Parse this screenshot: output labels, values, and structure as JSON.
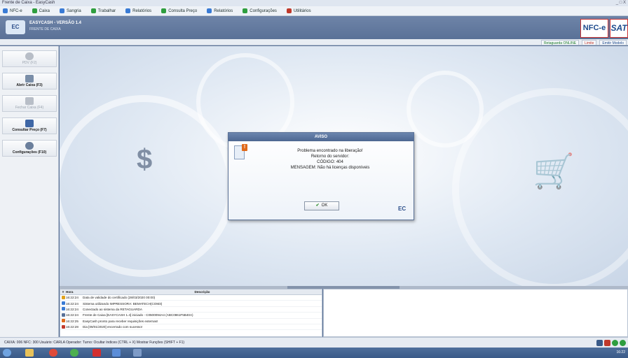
{
  "window": {
    "title": "Frente de Caixa - EasyCash",
    "controls": "_ □ X"
  },
  "menu": [
    {
      "label": "NFC-e",
      "color": "#3a7bd5"
    },
    {
      "label": "Caixa",
      "color": "#2e9e3f"
    },
    {
      "label": "Sangria",
      "color": "#3a7bd5"
    },
    {
      "label": "Trabalhar",
      "color": "#2e9e3f"
    },
    {
      "label": "Relatórios",
      "color": "#3a7bd5"
    },
    {
      "label": "Consulta Preço",
      "color": "#2e9e3f"
    },
    {
      "label": "Relatórios",
      "color": "#3a7bd5"
    },
    {
      "label": "Configurações",
      "color": "#2e9e3f"
    },
    {
      "label": "Utilitários",
      "color": "#c0392b"
    }
  ],
  "header": {
    "logo": "EC",
    "title": "EASYCASH - VERSÃO 1.4",
    "subtitle": "FRENTE DE CAIXA",
    "nfce": "NFC-e",
    "sat": "SAT"
  },
  "status_strip": {
    "online": "Retaguarda ONLINE",
    "limit": "Limite",
    "invoice": "Emitir Modelo"
  },
  "sidebar": [
    {
      "label": "PDV (F2)",
      "enabled": false,
      "icon": "cloud-icon"
    },
    {
      "label": "Abrir Caixa (F3)",
      "enabled": true,
      "icon": "open-register-icon"
    },
    {
      "label": "Fechar Caixa (F4)",
      "enabled": false,
      "icon": "close-register-icon"
    },
    {
      "label": "Consultar Preço (F7)",
      "enabled": true,
      "icon": "price-icon"
    },
    {
      "label": "Configurações (F10)",
      "enabled": true,
      "icon": "settings-icon"
    }
  ],
  "dialog": {
    "title": "AVISO",
    "lines": [
      "Problema encontrado na liberação!",
      "Retorno do servidor:",
      "CÓDIGO: 404",
      "MENSAGEM: Não há licenças disponíveis"
    ],
    "ok_label": "OK",
    "check_glyph": "✔",
    "logo": "EC"
  },
  "log": {
    "columns": [
      "#",
      "Hora",
      "Descrição"
    ],
    "rows": [
      {
        "color": "#e0a21c",
        "time": "16:22:24",
        "text": "Data de validade do certificado (28/03/2020 00:00)"
      },
      {
        "color": "#3a7bd5",
        "time": "16:22:24",
        "text": "Sistema utilizando IMPRESSORA: BEMATECH(COM3)"
      },
      {
        "color": "#3a7bd5",
        "time": "16:22:24",
        "text": "Conectado ao sistema da RETAGUARDA"
      },
      {
        "color": "#5a7197",
        "time": "16:22:24",
        "text": "Frente de Caixa [EASYCASH 1.4] iniciado - C0500094A4 (ABC0861F5B40A)"
      },
      {
        "color": "#e06a1a",
        "time": "16:22:25",
        "text": "EasyCash pronto para receber requisições externas!"
      },
      {
        "color": "#c0392b",
        "time": "16:22:28",
        "text": "Dia [09/01/2020] encerrado com sucesso!"
      }
    ]
  },
  "bottom_status": {
    "text": "CAIXA: 006   NFC: 300   Usuário: CARLA   Operador:   Turno:   Ocultar índices (CTRL + X)   Mostrar Funções (SHIFT + F1)"
  },
  "taskbar": {
    "clock": "16:22"
  }
}
